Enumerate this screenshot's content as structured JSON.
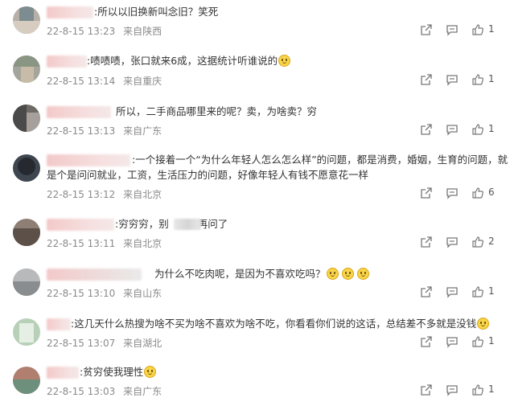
{
  "comments": [
    {
      "text": ":所以以旧换新叫念旧？笑死",
      "emoji_count": 0,
      "time": "22-8-15 13:23",
      "location": "来自陕西",
      "likes": "1"
    },
    {
      "text": ":啧啧啧，张口就来6成，这据统计听谁说的",
      "emoji_count": 1,
      "time": "22-8-15 13:14",
      "location": "来自重庆",
      "likes": "1"
    },
    {
      "text": "所以，二手商品哪里来的呢？卖，为啥卖？穷",
      "emoji_count": 0,
      "time": "22-8-15 13:13",
      "location": "来自广东",
      "likes": "1"
    },
    {
      "text": ":一个接着一个“为什么年轻人怎么怎么样”的问题，都是消费，婚姻，生育的问题，就",
      "text2": "是个是问问就业，工资，生活压力的问题，好像年轻人有钱不愿意花一样",
      "emoji_count": 0,
      "time": "22-8-15 13:12",
      "location": "来自北京",
      "likes": "6"
    },
    {
      "text": ":穷穷穷，别",
      "text_b": "再问了",
      "emoji_count": 0,
      "time": "22-8-15 13:11",
      "location": "来自北京",
      "likes": "2"
    },
    {
      "text": "为什么不吃肉呢，是因为不喜欢吃吗？",
      "emoji_count": 3,
      "time": "22-8-15 13:10",
      "location": "来自山东",
      "likes": "1"
    },
    {
      "text": ":这几天什么热搜为啥不买为啥不喜欢为啥不吃，你看看你们说的这话，总结差不多就是没钱",
      "emoji_count": 1,
      "time": "22-8-15 13:07",
      "location": "来自湖北",
      "likes": "1"
    },
    {
      "text": ":贫穷使我理性",
      "emoji_count": 1,
      "time": "22-8-15 13:03",
      "location": "来自广东",
      "likes": "1"
    }
  ],
  "icons": {
    "share": "share-icon",
    "comment": "comment-icon",
    "like": "thumbs-up-icon"
  },
  "colors": {
    "meta": "#8a8a8a",
    "text": "#333333",
    "name_blur": "#f3c9c9"
  }
}
